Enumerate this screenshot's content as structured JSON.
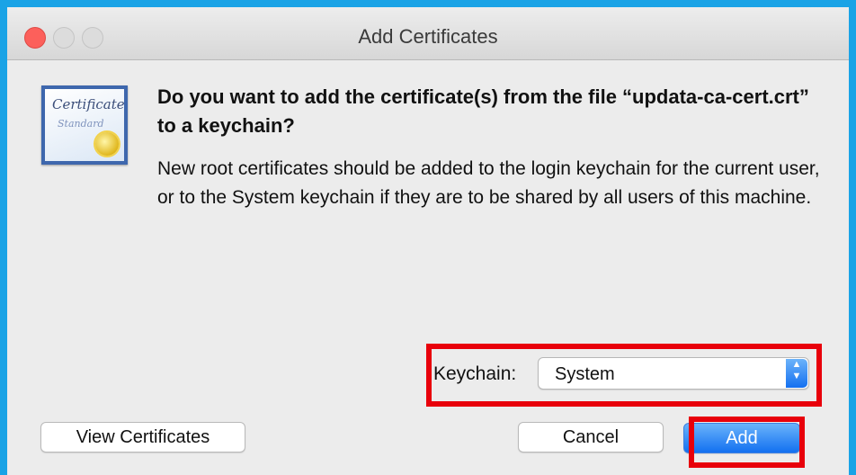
{
  "window": {
    "title": "Add Certificates"
  },
  "icon": {
    "word1": "Certificate",
    "word2": "Standard"
  },
  "dialog": {
    "question": "Do you want to add the certificate(s) from the file “updata-ca-cert.crt” to a keychain?",
    "description": "New root certificates should be added to the login keychain for the current user, or to the System keychain if they are to be shared by all users of this machine."
  },
  "keychain": {
    "label": "Keychain:",
    "selected": "System"
  },
  "buttons": {
    "view_certificates": "View Certificates",
    "cancel": "Cancel",
    "add": "Add"
  },
  "colors": {
    "accent": "#1270f0",
    "highlight": "#e8000b",
    "background": "#1aa3e6"
  }
}
